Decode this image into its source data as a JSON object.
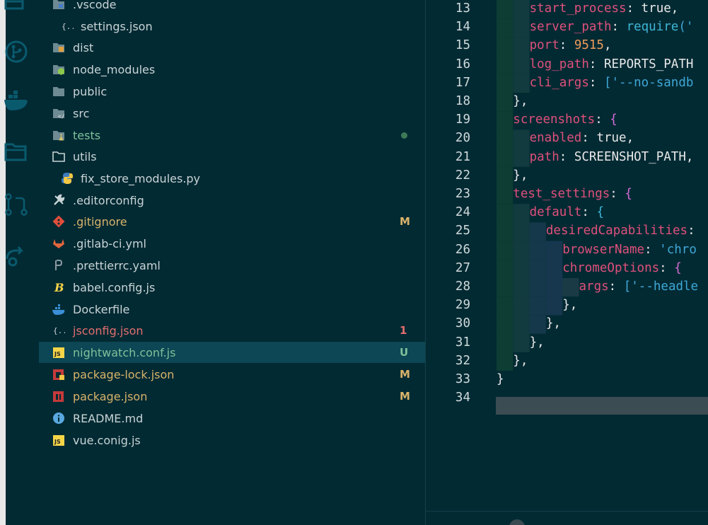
{
  "explorer": {
    "items": [
      {
        "label": ".vscode",
        "icon": "vscode-folder-icon",
        "color": "#c9d4d6"
      },
      {
        "label": "settings.json",
        "icon": "json-braces-icon",
        "color": "#c9d4d6"
      },
      {
        "label": "dist",
        "icon": "dist-folder-icon",
        "color": "#c9d4d6"
      },
      {
        "label": "node_modules",
        "icon": "node-folder-icon",
        "color": "#c9d4d6"
      },
      {
        "label": "public",
        "icon": "folder-icon",
        "color": "#c9d4d6"
      },
      {
        "label": "src",
        "icon": "src-folder-icon",
        "color": "#c9d4d6"
      },
      {
        "label": "tests",
        "icon": "tests-folder-icon",
        "color": "#7fc19a"
      },
      {
        "label": "utils",
        "icon": "open-folder-icon",
        "color": "#c9d4d6"
      },
      {
        "label": "fix_store_modules.py",
        "icon": "python-icon",
        "color": "#c9d4d6"
      },
      {
        "label": ".editorconfig",
        "icon": "wrench-icon",
        "color": "#c9d4d6"
      },
      {
        "label": ".gitignore",
        "icon": "git-icon",
        "color": "#d9b36a",
        "badge": "M"
      },
      {
        "label": ".gitlab-ci.yml",
        "icon": "gitlab-icon",
        "color": "#c9d4d6"
      },
      {
        "label": ".prettierrc.yaml",
        "icon": "prettier-icon",
        "color": "#c9d4d6"
      },
      {
        "label": "babel.config.js",
        "icon": "babel-icon",
        "color": "#c9d4d6"
      },
      {
        "label": "Dockerfile",
        "icon": "docker-icon",
        "color": "#c9d4d6"
      },
      {
        "label": "jsconfig.json",
        "icon": "json-braces-icon",
        "color": "#e56e6e",
        "badge": "1"
      },
      {
        "label": "nightwatch.conf.js",
        "icon": "js-icon",
        "color": "#7fc19a",
        "badge": "U"
      },
      {
        "label": "package-lock.json",
        "icon": "npm-lock-icon",
        "color": "#d9b36a",
        "badge": "M"
      },
      {
        "label": "package.json",
        "icon": "npm-icon",
        "color": "#d9b36a",
        "badge": "M"
      },
      {
        "label": "README.md",
        "icon": "info-icon",
        "color": "#c9d4d6"
      },
      {
        "label": "vue.conig.js",
        "icon": "js-icon",
        "color": "#c9d4d6"
      }
    ]
  },
  "editor": {
    "lines": [
      {
        "n": "13",
        "tokens": [
          [
            "start_process",
            "k"
          ],
          [
            ": ",
            "p"
          ],
          [
            "true",
            "b"
          ],
          [
            ",",
            "p"
          ]
        ]
      },
      {
        "n": "14",
        "tokens": [
          [
            "server_path",
            "k"
          ],
          [
            ": ",
            "p"
          ],
          [
            "require",
            "f"
          ],
          [
            "('",
            "s"
          ]
        ]
      },
      {
        "n": "15",
        "tokens": [
          [
            "port",
            "k"
          ],
          [
            ": ",
            "p"
          ],
          [
            "9515",
            "n"
          ],
          [
            ",",
            "p"
          ]
        ]
      },
      {
        "n": "16",
        "tokens": [
          [
            "log_path",
            "k"
          ],
          [
            ": ",
            "p"
          ],
          [
            "REPORTS_PATH",
            "v"
          ]
        ]
      },
      {
        "n": "17",
        "tokens": [
          [
            "cli_args",
            "k"
          ],
          [
            ": ",
            "p"
          ],
          [
            "['--no-sandb",
            "s"
          ]
        ]
      },
      {
        "n": "18",
        "tokens": [
          [
            "},",
            "p"
          ]
        ]
      },
      {
        "n": "19",
        "tokens": [
          [
            "screenshots",
            "k"
          ],
          [
            ": ",
            "p"
          ],
          [
            "{",
            "br"
          ]
        ]
      },
      {
        "n": "20",
        "tokens": [
          [
            "enabled",
            "k"
          ],
          [
            ": ",
            "p"
          ],
          [
            "true",
            "b"
          ],
          [
            ",",
            "p"
          ]
        ]
      },
      {
        "n": "21",
        "tokens": [
          [
            "path",
            "k"
          ],
          [
            ": ",
            "p"
          ],
          [
            "SCREENSHOT_PATH,",
            "v"
          ]
        ]
      },
      {
        "n": "22",
        "tokens": [
          [
            "},",
            "p"
          ]
        ]
      },
      {
        "n": "23",
        "tokens": [
          [
            "test_settings",
            "k"
          ],
          [
            ": ",
            "p"
          ],
          [
            "{",
            "br"
          ]
        ]
      },
      {
        "n": "24",
        "tokens": [
          [
            "default",
            "k"
          ],
          [
            ": ",
            "p"
          ],
          [
            "{",
            "f"
          ]
        ]
      },
      {
        "n": "25",
        "tokens": [
          [
            "desiredCapabilities",
            "k"
          ],
          [
            ":",
            "p"
          ]
        ]
      },
      {
        "n": "26",
        "tokens": [
          [
            "browserName",
            "k"
          ],
          [
            ": ",
            "p"
          ],
          [
            "'chro",
            "s"
          ]
        ]
      },
      {
        "n": "27",
        "tokens": [
          [
            "chromeOptions",
            "k"
          ],
          [
            ": ",
            "p"
          ],
          [
            "{",
            "br"
          ]
        ]
      },
      {
        "n": "28",
        "tokens": [
          [
            "args",
            "k"
          ],
          [
            ": ",
            "p"
          ],
          [
            "['--headle",
            "s"
          ]
        ]
      },
      {
        "n": "29",
        "tokens": [
          [
            "},",
            "p"
          ]
        ]
      },
      {
        "n": "30",
        "tokens": [
          [
            "},",
            "p"
          ]
        ]
      },
      {
        "n": "31",
        "tokens": [
          [
            "},",
            "p"
          ]
        ]
      },
      {
        "n": "32",
        "tokens": [
          [
            "},",
            "p"
          ]
        ]
      },
      {
        "n": "33",
        "tokens": [
          [
            "}",
            "p"
          ]
        ]
      },
      {
        "n": "34",
        "tokens": []
      }
    ]
  }
}
